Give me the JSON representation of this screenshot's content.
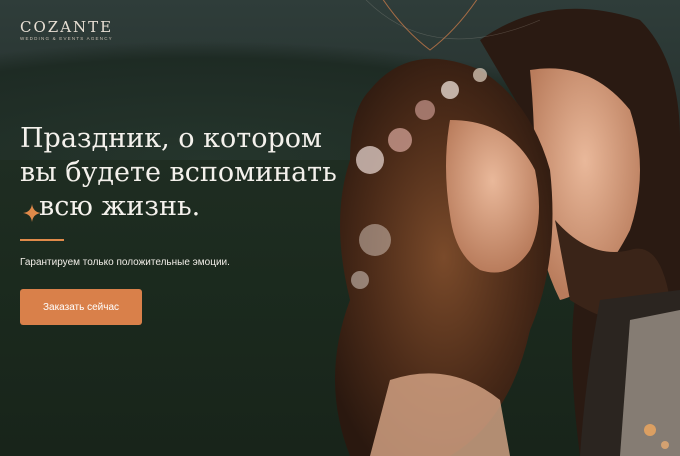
{
  "brand": {
    "name": "COZANTE",
    "tagline": "WEDDING & EVENTS AGENCY"
  },
  "hero": {
    "headline_line1": "Праздник, о котором",
    "headline_line2": "вы будете вспоминать",
    "headline_line3": "всю жизнь.",
    "subtitle": "Гарантируем только положительные эмоции.",
    "cta_label": "Заказать сейчас"
  },
  "colors": {
    "accent": "#d9804a",
    "background": "#1f2a24",
    "text": "#f4f1ec"
  },
  "icons": {
    "sparkle": "sparkle-icon"
  }
}
